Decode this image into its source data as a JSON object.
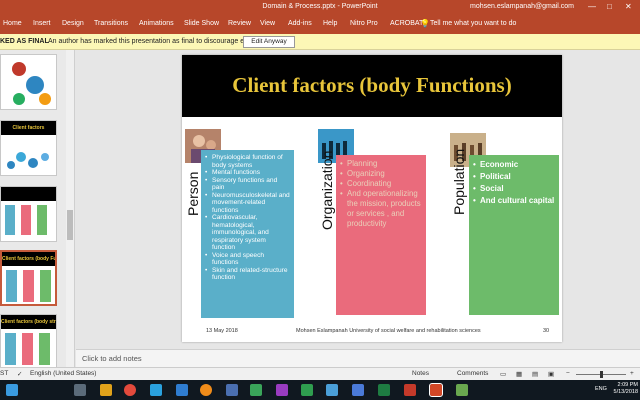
{
  "window": {
    "title": "Domain & Process.pptx - PowerPoint",
    "user": "mohsen.eslampanah@gmail.com",
    "controls": [
      "—",
      "□",
      "✕"
    ]
  },
  "ribbon": {
    "tabs": [
      "Home",
      "Insert",
      "Design",
      "Transitions",
      "Animations",
      "Slide Show",
      "Review",
      "View",
      "Add-ins",
      "Help",
      "Nitro Pro",
      "ACROBAT"
    ],
    "tell_me": "Tell me what you want to do"
  },
  "infobar": {
    "label": "KED AS FINAL",
    "message": "An author has marked this presentation as final to discourage editing.",
    "button": "Edit Anyway"
  },
  "thumbnails": [
    {
      "title": ""
    },
    {
      "title": "Client factors"
    },
    {
      "title": ""
    },
    {
      "title": "Client factors (body Functions)"
    },
    {
      "title": "Client factors (body structure)"
    }
  ],
  "slide": {
    "title": "Client factors (body Functions)",
    "columns": [
      {
        "label": "Person",
        "color": "#5aafc9",
        "items": [
          "Physiological function of body systems",
          "Mental functions",
          "Sensory functions and pain",
          "Neuromusculoskeletal and movement-related functions",
          "Cardiovascular, hematological, immunological, and respiratory system function",
          "Voice and speech functions",
          "Skin  and related-structure function"
        ]
      },
      {
        "label": "Organization",
        "color": "#ea6b7c",
        "items": [
          "Planning",
          "Organizing",
          "Coordinating",
          "And operationalizing the mission, products or services , and productivity"
        ]
      },
      {
        "label": "Population",
        "color": "#6dbb6a",
        "items": [
          "Economic",
          "Political",
          "Social",
          "And cultural capital"
        ]
      }
    ],
    "footer": {
      "date": "13 May 2018",
      "author": "Mohsen Eslampanah University of social welfare and rehabilitation sciences",
      "number": "30"
    }
  },
  "notes": {
    "placeholder": "Click to add notes"
  },
  "statusbar": {
    "slide": "ST",
    "language": "English (United States)",
    "notes": "Notes",
    "comments": "Comments"
  },
  "taskbar": {
    "language": "ENG",
    "time": "2:09 PM",
    "date": "5/13/2018"
  }
}
